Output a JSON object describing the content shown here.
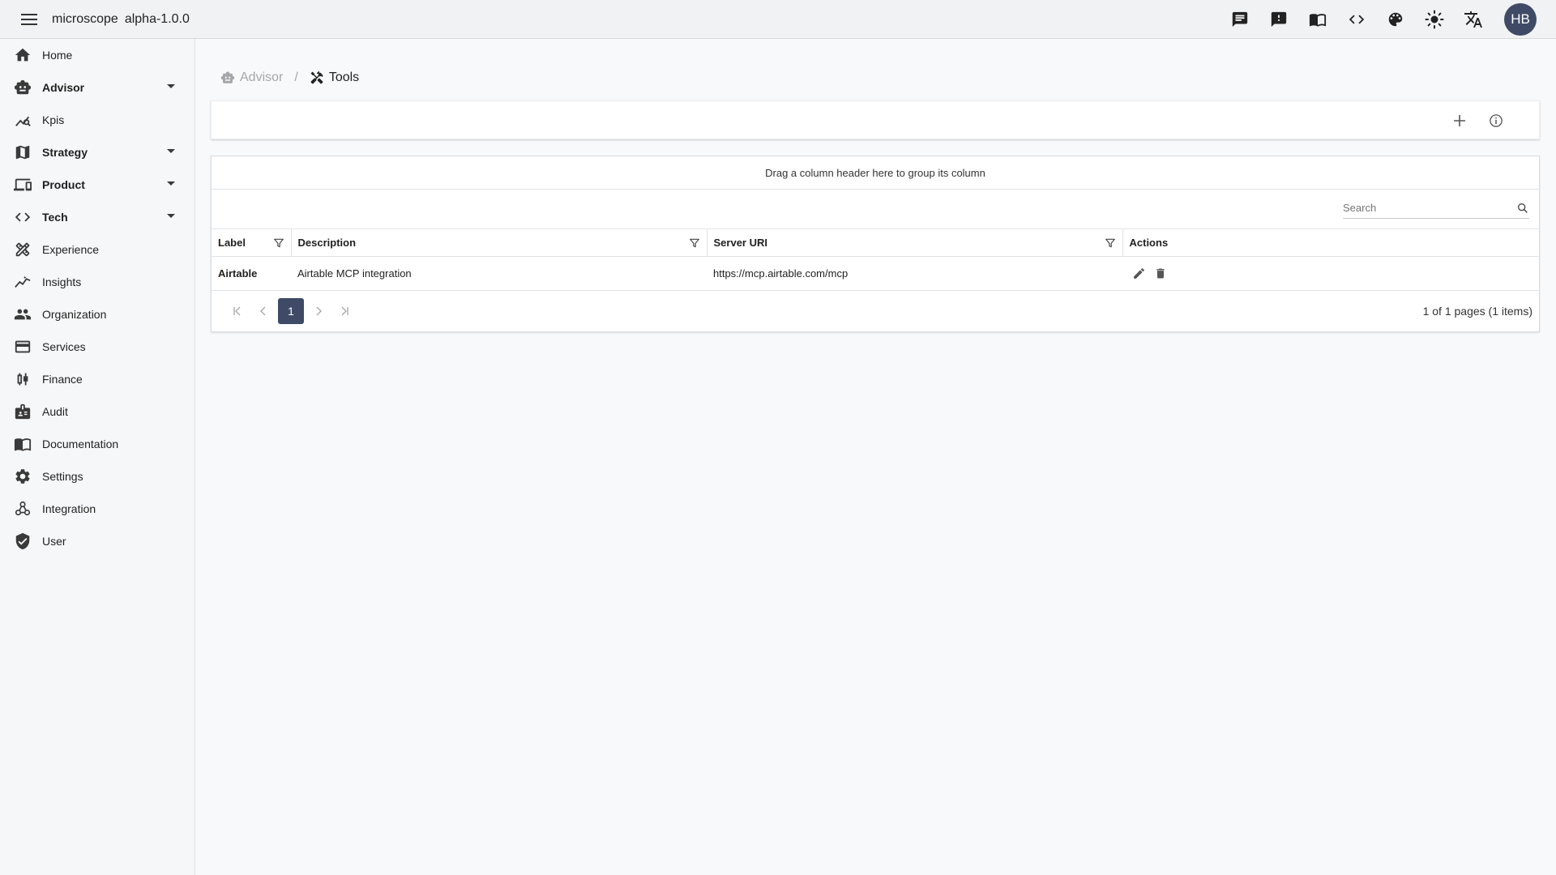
{
  "app": {
    "name": "microscope",
    "version": "alpha-1.0.0"
  },
  "topbar": {
    "icons": [
      "chat-icon",
      "feedback-icon",
      "docs-book-icon",
      "code-icon",
      "palette-icon",
      "brightness-icon",
      "translate-icon"
    ],
    "avatar_initials": "HB"
  },
  "sidebar": {
    "items": [
      {
        "label": "Home",
        "icon": "home-icon",
        "expandable": false
      },
      {
        "label": "Advisor",
        "icon": "robot-icon",
        "expandable": true
      },
      {
        "label": "Kpis",
        "icon": "chart-line-icon",
        "expandable": false
      },
      {
        "label": "Strategy",
        "icon": "map-icon",
        "expandable": true
      },
      {
        "label": "Product",
        "icon": "devices-icon",
        "expandable": true
      },
      {
        "label": "Tech",
        "icon": "code-icon",
        "expandable": true
      },
      {
        "label": "Experience",
        "icon": "design-icon",
        "expandable": false
      },
      {
        "label": "Insights",
        "icon": "insights-icon",
        "expandable": false
      },
      {
        "label": "Organization",
        "icon": "people-icon",
        "expandable": false
      },
      {
        "label": "Services",
        "icon": "card-icon",
        "expandable": false
      },
      {
        "label": "Finance",
        "icon": "candlestick-icon",
        "expandable": false
      },
      {
        "label": "Audit",
        "icon": "badge-icon",
        "expandable": false
      },
      {
        "label": "Documentation",
        "icon": "book-icon",
        "expandable": false
      },
      {
        "label": "Settings",
        "icon": "gear-icon",
        "expandable": false
      },
      {
        "label": "Integration",
        "icon": "webhook-icon",
        "expandable": false
      },
      {
        "label": "User",
        "icon": "shield-check-icon",
        "expandable": false
      }
    ]
  },
  "breadcrumb": {
    "parent": "Advisor",
    "current": "Tools"
  },
  "grid": {
    "group_panel_text": "Drag a column header here to group its column",
    "search_placeholder": "Search",
    "columns": [
      "Label",
      "Description",
      "Server URI",
      "Actions"
    ],
    "rows": [
      {
        "label": "Airtable",
        "description": "Airtable MCP integration",
        "server_uri": "https://mcp.airtable.com/mcp"
      }
    ],
    "pager": {
      "current_page": "1",
      "info": "1 of 1 pages (1 items)"
    }
  },
  "colors": {
    "accent": "#3f4a66",
    "topbar_bg": "#f1f2f3",
    "sidebar_bg": "#f6f7f8",
    "content_bg": "#f8f9fa"
  }
}
